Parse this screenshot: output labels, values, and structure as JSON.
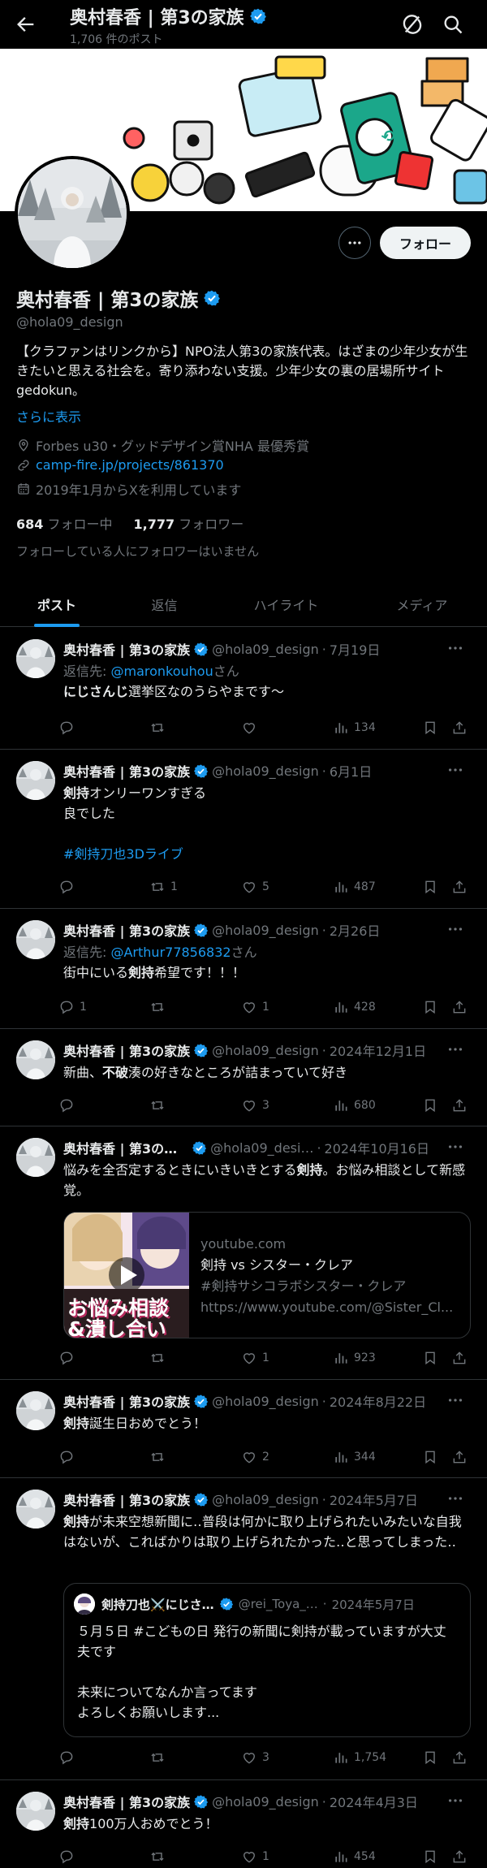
{
  "header": {
    "title": "奥村春香 | 第3の家族",
    "post_count": "1,706 件のポスト"
  },
  "profile": {
    "name": "奥村春香 | 第3の家族",
    "handle": "@hola09_design",
    "bio": "【クラファンはリンクから】NPO法人第3の家族代表。はざまの少年少女が生きたいと思える社会を。寄り添わない支援。少年少女の裏の居場所サイトgedokun。",
    "show_more": "さらに表示",
    "profession": "Forbes u30・グッドデザイン賞NHA 最優秀賞",
    "link": "camp-fire.jp/projects/861370",
    "joined": "2019年1月からXを利用しています",
    "following_count": "684",
    "following_label": "フォロー中",
    "followers_count": "1,777",
    "followers_label": "フォロワー",
    "followers_note": "フォローしている人にフォロワーはいません",
    "follow_button": "フォロー"
  },
  "tabs": [
    "ポスト",
    "返信",
    "ハイライト",
    "メディア"
  ],
  "colors": {
    "accent": "#1d9bf0",
    "background": "#000000",
    "verified": "#1d9bf0"
  },
  "posts": [
    {
      "name": "奥村春香 | 第3の家族",
      "handle": "@hola09_design",
      "date": "7月19日",
      "reply_label": "返信先: ",
      "reply_to": "@maronkouhou",
      "reply_suffix": "さん",
      "text_bold": "にじさんじ",
      "text": "選挙区なのうらやまです〜",
      "replies": "",
      "reposts": "",
      "likes": "",
      "views": "134"
    },
    {
      "name": "奥村春香 | 第3の家族",
      "handle": "@hola09_design",
      "date": "6月1日",
      "text_bold": "剣持",
      "text": "オンリーワンすぎる",
      "text2": "良でした",
      "hashtag": "#剣持刀也3Dライブ",
      "replies": "",
      "reposts": "1",
      "likes": "5",
      "views": "487"
    },
    {
      "name": "奥村春香 | 第3の家族",
      "handle": "@hola09_design",
      "date": "2月26日",
      "reply_label": "返信先: ",
      "reply_to": "@Arthur77856832",
      "reply_suffix": "さん",
      "text_pre": "街中にいる",
      "text_bold": "剣持",
      "text": "希望です！！！",
      "replies": "1",
      "reposts": "",
      "likes": "1",
      "views": "428"
    },
    {
      "name": "奥村春香 | 第3の家族",
      "handle": "@hola09_design",
      "date": "2024年12月1日",
      "text_pre": "新曲、",
      "text_bold": "不破",
      "text": "湊の好きなところが詰まっていて好き",
      "replies": "",
      "reposts": "",
      "likes": "3",
      "views": "680"
    },
    {
      "name": "奥村春香 | 第3の…",
      "handle": "@hola09_desi…",
      "date": "2024年10月16日",
      "text_pre": "悩みを全否定するときにいきいきとする",
      "text_bold": "剣持",
      "text": "。お悩み相談として新感覚。",
      "card": {
        "domain": "youtube.com",
        "title": "剣持 vs シスター・クレア",
        "subtitle": "#剣持サシコラボシスター・クレア",
        "url": "https://www.youtube.com/@Sister_Cl...",
        "thumb_text1": "お悩み相談",
        "thumb_text2": "&潰し合い"
      },
      "replies": "",
      "reposts": "",
      "likes": "1",
      "views": "923"
    },
    {
      "name": "奥村春香 | 第3の家族",
      "handle": "@hola09_design",
      "date": "2024年8月22日",
      "text_bold": "剣持",
      "text": "誕生日おめでとう！",
      "replies": "",
      "reposts": "",
      "likes": "2",
      "views": "344"
    },
    {
      "name": "奥村春香 | 第3の家族",
      "handle": "@hola09_design",
      "date": "2024年5月7日",
      "text_bold": "剣持",
      "text": "が未来空想新聞に‥普段は何かに取り上げられたいみたいな自我はないが、こればかりは取り上げられたかった‥と思ってしまった‥",
      "quote": {
        "name": "剣持刀也⚔️にじさ…",
        "handle": "@rei_Toya_…",
        "date": "2024年5月7日",
        "line1": "５月５日 #こどもの日 発行の新聞に剣持が載っていますが大丈夫です",
        "line2": "未来についてなんか言ってます",
        "line3": "よろしくお願いします..."
      },
      "replies": "",
      "reposts": "",
      "likes": "3",
      "views": "1,754"
    },
    {
      "name": "奥村春香 | 第3の家族",
      "handle": "@hola09_design",
      "date": "2024年4月3日",
      "text_bold": "剣持",
      "text": "100万人おめでとう！",
      "replies": "",
      "reposts": "",
      "likes": "1",
      "views": "454"
    }
  ]
}
